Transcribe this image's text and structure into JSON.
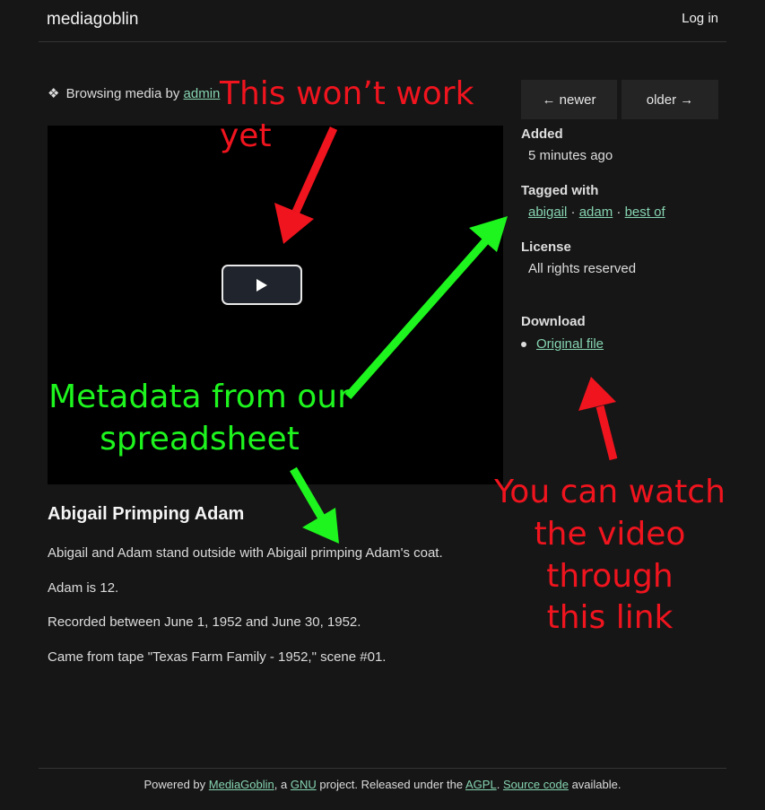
{
  "header": {
    "logo": "mediagoblin",
    "login": "Log in"
  },
  "browsing": {
    "icon": "❖",
    "prefix": "Browsing media by",
    "user": "admin"
  },
  "nav": {
    "newer": "← newer",
    "older": "older →"
  },
  "video": {
    "play_icon": "play-icon"
  },
  "media": {
    "title": "Abigail Primping Adam",
    "description": [
      "Abigail and Adam stand outside with Abigail primping Adam's coat.",
      "Adam is 12.",
      "Recorded between June 1, 1952 and June 30, 1952.",
      "Came from tape \"Texas Farm Family - 1952,\" scene #01."
    ]
  },
  "sidebar": {
    "added_label": "Added",
    "added_value": "5 minutes ago",
    "tags_label": "Tagged with",
    "tags": [
      "abigail",
      "adam",
      "best of"
    ],
    "tag_separator": "·",
    "license_label": "License",
    "license_value": "All rights reserved",
    "download_label": "Download",
    "download_link": "Original file"
  },
  "annotations": {
    "wont_work": "This won’t work yet",
    "metadata_line1": "Metadata from our",
    "metadata_line2": "spreadsheet",
    "watch_line1": "You can watch",
    "watch_line2": "the video through",
    "watch_line3": "this link",
    "red": "#f0141e",
    "green": "#1ef51e"
  },
  "footer": {
    "t1": "Powered by",
    "l1": "MediaGoblin",
    "t2": ", a",
    "l2": "GNU",
    "t3": "project. Released under the",
    "l3": "AGPL",
    "t4": ".",
    "l4": "Source code",
    "t5": "available."
  }
}
